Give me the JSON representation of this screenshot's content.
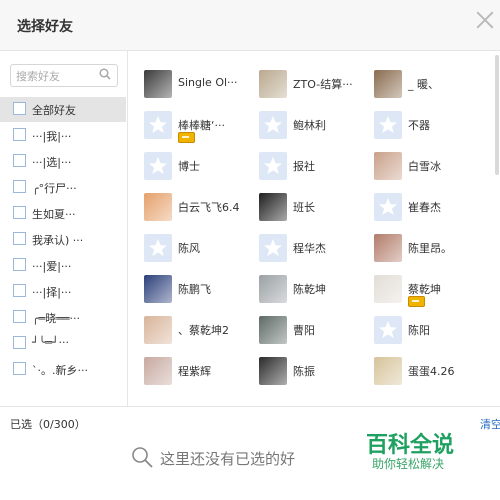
{
  "dialog": {
    "title": "选择好友"
  },
  "search": {
    "placeholder": "搜索好友"
  },
  "groups": [
    {
      "label": "全部好友"
    },
    {
      "label": "···|我|···"
    },
    {
      "label": "···|选|···"
    },
    {
      "label": "╭°行尸···"
    },
    {
      "label": "生如夏···"
    },
    {
      "label": "我承认) ···"
    },
    {
      "label": "···|爱|···"
    },
    {
      "label": "···|择|···"
    },
    {
      "label": "╭═晓══···"
    },
    {
      "label": "┘╰═┘···"
    },
    {
      "label": "`·。.新乡···"
    }
  ],
  "friends": [
    {
      "name": "Single Ol···",
      "avatar": "photo",
      "color": "#3a3a3a",
      "badge": false
    },
    {
      "name": "ZTO-结算···",
      "avatar": "photo",
      "color": "#b9a88d",
      "badge": false
    },
    {
      "name": "_ 暖、",
      "avatar": "photo",
      "color": "#8a6b4e",
      "badge": false
    },
    {
      "name": "棒棒糖‘···",
      "avatar": "default",
      "badge": true
    },
    {
      "name": "鲍林利",
      "avatar": "default",
      "badge": false
    },
    {
      "name": "不器",
      "avatar": "default",
      "badge": false
    },
    {
      "name": "博士",
      "avatar": "default",
      "badge": false
    },
    {
      "name": "报社",
      "avatar": "default",
      "badge": false
    },
    {
      "name": "白雪冰",
      "avatar": "photo",
      "color": "#c9a08a",
      "badge": false
    },
    {
      "name": "白云飞飞6.4",
      "avatar": "photo",
      "color": "#e5a06b",
      "badge": false
    },
    {
      "name": "班长",
      "avatar": "photo",
      "color": "#1e1e1e",
      "badge": false
    },
    {
      "name": "崔春杰",
      "avatar": "default",
      "badge": false
    },
    {
      "name": "陈风",
      "avatar": "default",
      "badge": false
    },
    {
      "name": "程华杰",
      "avatar": "default",
      "badge": false
    },
    {
      "name": "陈里昂。",
      "avatar": "photo",
      "color": "#b27c6a",
      "badge": false
    },
    {
      "name": "陈鹏飞",
      "avatar": "photo",
      "color": "#2b3f7a",
      "badge": false
    },
    {
      "name": "陈乾坤",
      "avatar": "photo",
      "color": "#9aa0a4",
      "badge": false
    },
    {
      "name": "蔡乾坤",
      "avatar": "photo",
      "color": "#e2ddd6",
      "badge": true
    },
    {
      "name": "、蔡乾坤2",
      "avatar": "photo",
      "color": "#d8b49a",
      "badge": false
    },
    {
      "name": "曹阳",
      "avatar": "photo",
      "color": "#5e6a66",
      "badge": false
    },
    {
      "name": "陈阳",
      "avatar": "default",
      "badge": false
    },
    {
      "name": "程紫辉",
      "avatar": "photo",
      "color": "#c7a9a0",
      "badge": false
    },
    {
      "name": "陈振",
      "avatar": "photo",
      "color": "#2a2a2a",
      "badge": false
    },
    {
      "name": "蛋蛋4.26",
      "avatar": "photo",
      "color": "#d6c39a",
      "badge": false
    }
  ],
  "footer": {
    "selected": "已选（0/300）",
    "clear": "清空",
    "empty_text": "这里还没有已选的好",
    "watermark_title": "百科全说",
    "watermark_sub": "助你轻松解决"
  },
  "colors": {
    "accent": "#2a6ec2",
    "watermark": "#1ea160",
    "default_avatar": "#dde7f6"
  }
}
